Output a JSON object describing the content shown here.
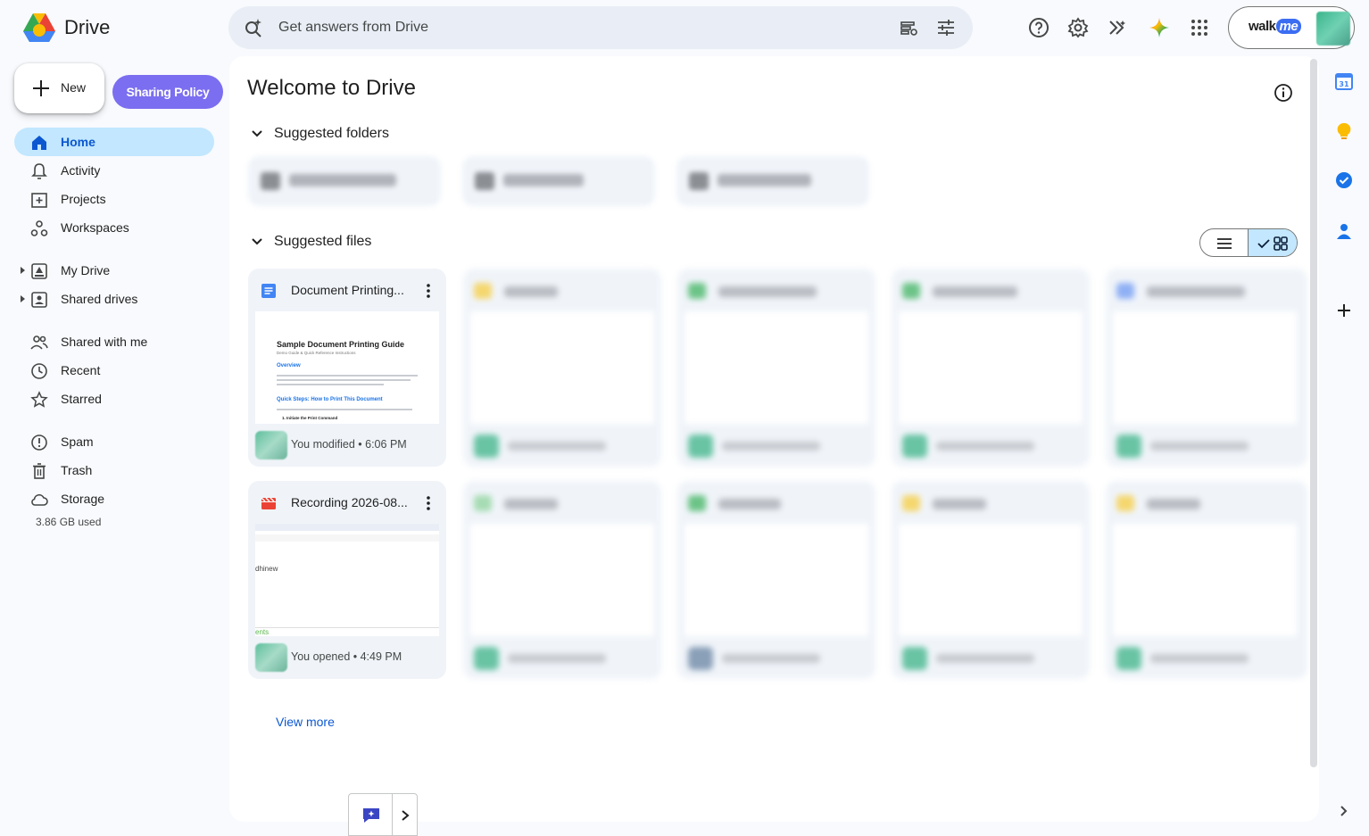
{
  "app": {
    "name": "Drive"
  },
  "search": {
    "placeholder": "Get answers from Drive"
  },
  "account": {
    "brand_text": "walk",
    "brand_badge": "me"
  },
  "sidebar": {
    "new_label": "New",
    "policy_label": "Sharing Policy",
    "items": [
      {
        "label": "Home",
        "icon": "home-icon",
        "active": true
      },
      {
        "label": "Activity",
        "icon": "bell-icon"
      },
      {
        "label": "Projects",
        "icon": "projects-icon"
      },
      {
        "label": "Workspaces",
        "icon": "workspaces-icon"
      },
      {
        "label": "My Drive",
        "icon": "my-drive-icon"
      },
      {
        "label": "Shared drives",
        "icon": "shared-drives-icon"
      },
      {
        "label": "Shared with me",
        "icon": "people-icon"
      },
      {
        "label": "Recent",
        "icon": "clock-icon"
      },
      {
        "label": "Starred",
        "icon": "star-icon"
      },
      {
        "label": "Spam",
        "icon": "spam-icon"
      },
      {
        "label": "Trash",
        "icon": "trash-icon"
      },
      {
        "label": "Storage",
        "icon": "cloud-icon"
      }
    ],
    "storage_used": "3.86 GB used"
  },
  "main": {
    "title": "Welcome to Drive",
    "suggested_folders_label": "Suggested folders",
    "suggested_files_label": "Suggested files",
    "view_more": "View more",
    "files": [
      {
        "name": "Document Printing...",
        "meta": "You modified • 6:06 PM",
        "type": "doc",
        "preview": {
          "title": "Sample Document Printing Guide",
          "subtitle": "Demo Guide & Quick Reference Instructions",
          "h1": "Overview",
          "h2": "Quick Steps: How to Print This Document",
          "step": "1. Initiate the Print Command"
        }
      },
      {
        "name": "Recording 2026-08...",
        "meta": "You opened • 4:49 PM",
        "type": "video",
        "preview": {
          "word": "dhinew",
          "footer": "ents"
        }
      }
    ]
  },
  "colors": {
    "accent": "#0b57d0",
    "active_bg": "#c2e7ff",
    "policy_bg": "#7b6ef0",
    "surface": "#f0f4f9"
  }
}
